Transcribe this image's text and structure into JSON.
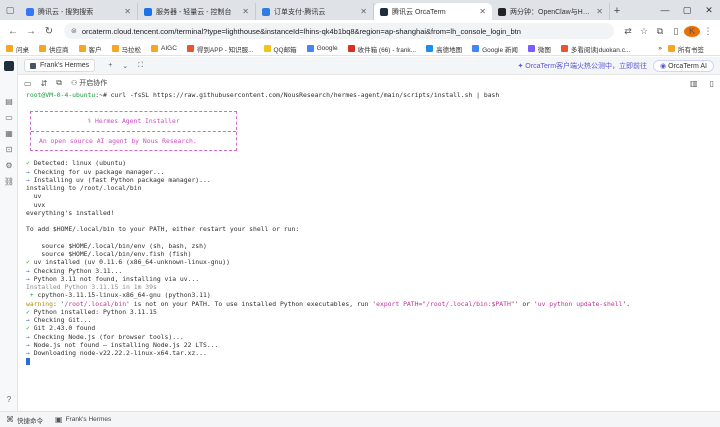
{
  "browser": {
    "tabs": [
      {
        "title": "腾讯云 - 搜狗搜索",
        "favicon_color": "#3478f6",
        "active": false
      },
      {
        "title": "服务器 - 轻量云 - 控制台",
        "favicon_color": "#1a73e8",
        "active": false
      },
      {
        "title": "订单支付-腾讯云",
        "favicon_color": "#2f7de1",
        "active": false
      },
      {
        "title": "腾讯云 OrcaTerm",
        "favicon_color": "#1f2d3d",
        "active": true
      },
      {
        "title": "两分钟：OpenClaw与Herme",
        "favicon_color": "#222222",
        "active": false
      }
    ],
    "new_tab_symbol": "+",
    "url": "orcaterm.cloud.tencent.com/terminal?type=lighthouse&instanceId=lhins-qk4b1bq8&region=ap-shanghai&from=lh_console_login_btn",
    "profile_initial": "K",
    "bookmarks": [
      {
        "label": "问桌",
        "color": "#f5a623"
      },
      {
        "label": "供应商",
        "color": "#f5a623"
      },
      {
        "label": "客户",
        "color": "#f5a623"
      },
      {
        "label": "马拉松",
        "color": "#f5a623"
      },
      {
        "label": "AIGC",
        "color": "#f5a623"
      },
      {
        "label": "得到APP - 知识服...",
        "color": "#e8552f"
      },
      {
        "label": "QQ邮箱",
        "color": "#f0c419"
      },
      {
        "label": "Google",
        "color": "#4285f4"
      },
      {
        "label": "收件箱 (66) - frank...",
        "color": "#d93025"
      },
      {
        "label": "高德地图",
        "color": "#1f8ef1"
      },
      {
        "label": "Google 新闻",
        "color": "#4285f4"
      },
      {
        "label": "微图",
        "color": "#7b5cff"
      },
      {
        "label": "多看阅读|duokan.c...",
        "color": "#e8552f"
      }
    ],
    "bookmarks_all": "所有书签"
  },
  "app": {
    "host_tab": "Frank's Hermes",
    "collab_label": "开启协作",
    "promo_text": "OrcaTerm客户端火热公测中，立即前往",
    "ai_button": "OrcaTerm AI"
  },
  "terminal": {
    "prompt_user": "root@VM-0-4-ubuntu",
    "prompt_rest": ":~# curl -fsSL https://raw.githubusercontent.com/NousResearch/hermes-agent/main/scripts/install.sh | bash",
    "banner_title": "⚕ Hermes Agent Installer",
    "banner_sub": "An open source AI agent by Nous Research.",
    "lines": [
      {
        "prefix": "✓ ",
        "prefix_class": "c-green",
        "text": "Detected: linux (ubuntu)",
        "class": ""
      },
      {
        "prefix": "→ ",
        "prefix_class": "c-blue",
        "text": "Checking for uv package manager...",
        "class": ""
      },
      {
        "prefix": "→ ",
        "prefix_class": "c-blue",
        "text": "Installing uv (fast Python package manager)...",
        "class": ""
      },
      {
        "prefix": "",
        "prefix_class": "",
        "text": "installing to /root/.local/bin",
        "class": ""
      },
      {
        "prefix": "",
        "prefix_class": "",
        "text": "  uv",
        "class": ""
      },
      {
        "prefix": "",
        "prefix_class": "",
        "text": "  uvx",
        "class": ""
      },
      {
        "prefix": "",
        "prefix_class": "",
        "text": "everything's installed!",
        "class": ""
      },
      {
        "prefix": "",
        "prefix_class": "",
        "text": "",
        "class": ""
      },
      {
        "prefix": "",
        "prefix_class": "",
        "text": "To add $HOME/.local/bin to your PATH, either restart your shell or run:",
        "class": ""
      },
      {
        "prefix": "",
        "prefix_class": "",
        "text": "",
        "class": ""
      },
      {
        "prefix": "",
        "prefix_class": "",
        "text": "    source $HOME/.local/bin/env (sh, bash, zsh)",
        "class": ""
      },
      {
        "prefix": "",
        "prefix_class": "",
        "text": "    source $HOME/.local/bin/env.fish (fish)",
        "class": ""
      },
      {
        "prefix": "✓ ",
        "prefix_class": "c-green",
        "text": "uv installed (uv 0.11.6 (x86_64-unknown-linux-gnu))",
        "class": ""
      },
      {
        "prefix": "→ ",
        "prefix_class": "c-blue",
        "text": "Checking Python 3.11...",
        "class": ""
      },
      {
        "prefix": "→ ",
        "prefix_class": "c-blue",
        "text": "Python 3.11 not found, installing via uv...",
        "class": ""
      },
      {
        "prefix": "",
        "prefix_class": "",
        "text": "Installed Python 3.11.15 in 1m 39s",
        "class": "c-gray"
      },
      {
        "prefix": " + ",
        "prefix_class": "c-green",
        "text": "cpython-3.11.15-linux-x86_64-gnu (python3.11)",
        "class": ""
      }
    ],
    "warning_prefix": "warning",
    "warning_text_a": ": '",
    "warning_path": "/root/.local/bin",
    "warning_text_b": "' is not on your PATH. To use installed Python executables, run '",
    "warning_cmd_a": "export PATH=\"/root/.local/bin:$PATH\"",
    "warning_text_c": "' or '",
    "warning_cmd_b": "uv python update-shell",
    "warning_text_d": "'.",
    "lines2": [
      {
        "prefix": "✓ ",
        "prefix_class": "c-green",
        "text": "Python installed: Python 3.11.15",
        "class": ""
      },
      {
        "prefix": "→ ",
        "prefix_class": "c-blue",
        "text": "Checking Git...",
        "class": ""
      },
      {
        "prefix": "✓ ",
        "prefix_class": "c-green",
        "text": "Git 2.43.0 found",
        "class": ""
      },
      {
        "prefix": "→ ",
        "prefix_class": "c-blue",
        "text": "Checking Node.js (for browser tools)...",
        "class": ""
      },
      {
        "prefix": "→ ",
        "prefix_class": "c-blue",
        "text": "Node.js not found — installing Node.js 22 LTS...",
        "class": ""
      },
      {
        "prefix": "→ ",
        "prefix_class": "c-blue",
        "text": "Downloading node-v22.22.2-linux-x64.tar.xz...",
        "class": ""
      }
    ]
  },
  "statusbar": {
    "shortcuts_label": "快捷命令",
    "host_label": "Frank's Hermes"
  }
}
